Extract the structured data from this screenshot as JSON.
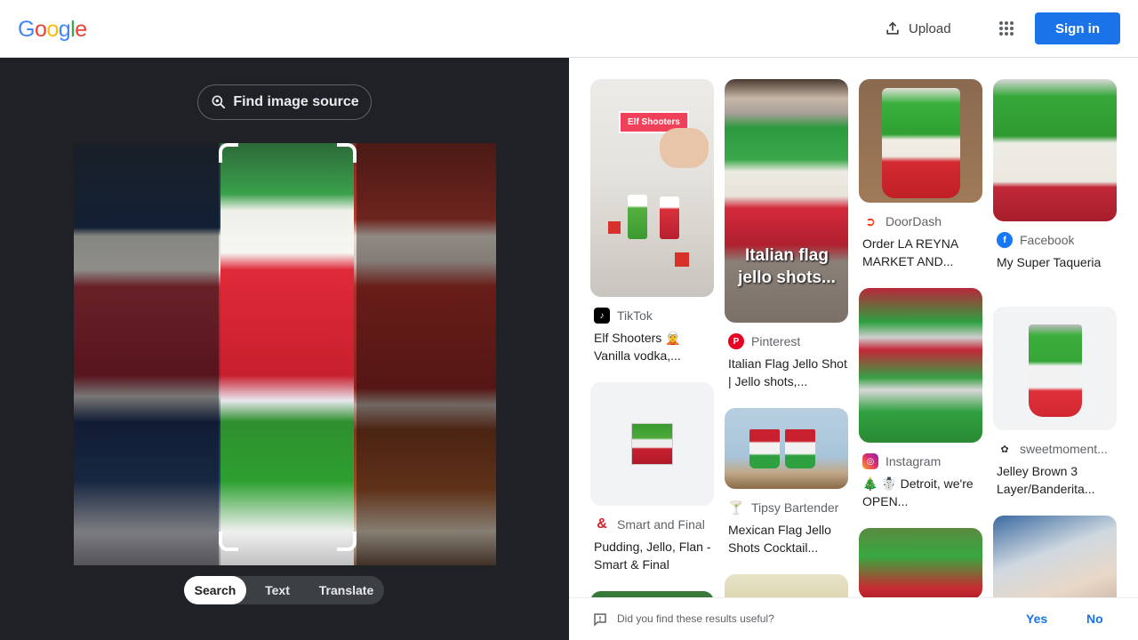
{
  "header": {
    "logo": [
      "G",
      "o",
      "o",
      "g",
      "l",
      "e"
    ],
    "logo_colors": [
      "#4285F4",
      "#EA4335",
      "#FBBC05",
      "#4285F4",
      "#34A853",
      "#EA4335"
    ],
    "upload_label": "Upload",
    "signin_label": "Sign in",
    "accent": "#1a73e8"
  },
  "lens": {
    "find_source_label": "Find image source",
    "tabs": [
      {
        "label": "Search",
        "active": true
      },
      {
        "label": "Text",
        "active": false
      },
      {
        "label": "Translate",
        "active": false
      }
    ]
  },
  "results": {
    "col1": [
      {
        "source": "TikTok",
        "title": "Elf Shooters 🧝 Vanilla vodka,...",
        "overlay": "Elf Shooters"
      },
      {
        "source": "Smart and Final",
        "title": "Pudding, Jello, Flan - Smart & Final"
      }
    ],
    "col2": [
      {
        "source": "Pinterest",
        "title": "Italian Flag Jello Shot | Jello shots,...",
        "overlay": "Italian flag jello shots..."
      },
      {
        "source": "Tipsy Bartender",
        "title": "Mexican Flag Jello Shots Cocktail..."
      }
    ],
    "col3": [
      {
        "source": "DoorDash",
        "title": "Order LA REYNA MARKET AND..."
      },
      {
        "source": "Instagram",
        "title": "🎄 ☃️ Detroit, we're OPEN..."
      }
    ],
    "col4": [
      {
        "source": "Facebook",
        "title": "My Super Taqueria"
      },
      {
        "source": "sweetmoment...",
        "title": "Jelley Brown 3 Layer/Banderita..."
      }
    ]
  },
  "feedback": {
    "question": "Did you find these results useful?",
    "yes": "Yes",
    "no": "No"
  }
}
